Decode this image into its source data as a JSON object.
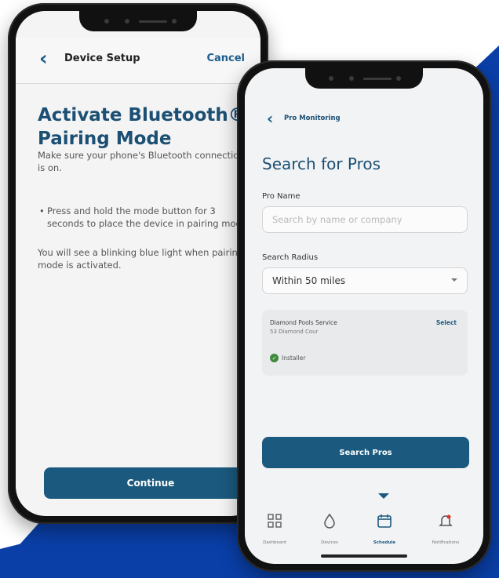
{
  "colors": {
    "brand": "#1b5a7e",
    "accent_blue": "#0a3fa8",
    "success": "#3f8a3e"
  },
  "setup": {
    "back_icon": "chevron-left-icon",
    "title": "Device Setup",
    "cancel": "Cancel",
    "heading": "Activate Bluetooth® Pairing Mode",
    "intro": "Make sure your phone's Bluetooth connection is on.",
    "bullet": "Press and hold the mode button for 3 seconds to place the device in pairing mode.",
    "note": "You will see a blinking blue light when pairing mode is activated.",
    "continue": "Continue"
  },
  "pro": {
    "back_icon": "chevron-left-icon",
    "title": "Pro Monitoring",
    "heading": "Search for Pros",
    "name_label": "Pro Name",
    "name_placeholder": "Search by name or company",
    "radius_label": "Search Radius",
    "radius_value": "Within 50 miles",
    "result": {
      "name": "Diamond Pools Service",
      "address": "53 Diamond Cour",
      "select": "Select",
      "badge": "Installer"
    },
    "search_button": "Search Pros",
    "tabs": [
      {
        "label": "Dashboard",
        "icon": "dashboard-grid-icon"
      },
      {
        "label": "Devices",
        "icon": "water-drop-icon"
      },
      {
        "label": "Schedule",
        "icon": "calendar-icon"
      },
      {
        "label": "Notifications",
        "icon": "bell-icon"
      }
    ]
  }
}
